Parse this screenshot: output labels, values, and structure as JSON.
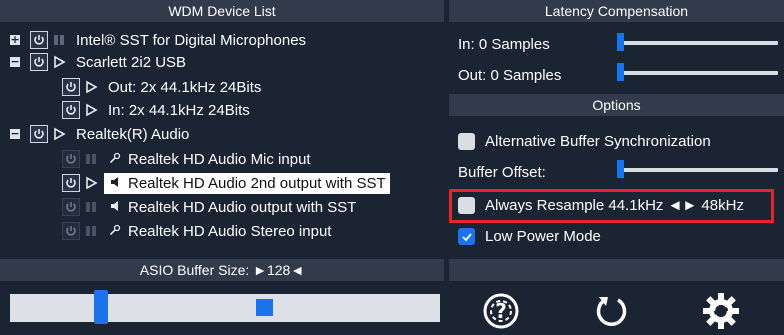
{
  "left_panel": {
    "header": "WDM Device List",
    "devices": [
      {
        "label": "Intel® SST for Digital Microphones",
        "expander": "+"
      },
      {
        "label": "Scarlett 2i2 USB",
        "expander": "−"
      },
      {
        "label": "Out: 2x 44.1kHz 24Bits"
      },
      {
        "label": "In: 2x 44.1kHz 24Bits"
      },
      {
        "label": "Realtek(R) Audio",
        "expander": "−"
      },
      {
        "label": "Realtek HD Audio Mic input"
      },
      {
        "label": "Realtek HD Audio 2nd output with SST"
      },
      {
        "label": "Realtek HD Audio output with SST"
      },
      {
        "label": "Realtek HD Audio Stereo input"
      }
    ],
    "buffer_header": "ASIO Buffer Size: ►128◄",
    "buffer_slider_value": 128
  },
  "right_panel": {
    "latency_header": "Latency Compensation",
    "in_label": "In: 0 Samples",
    "out_label": "Out: 0 Samples",
    "options_header": "Options",
    "alt_buffer_sync": {
      "label": "Alternative Buffer Synchronization",
      "checked": false
    },
    "buffer_offset_label": "Buffer Offset:",
    "always_resample": {
      "label": "Always Resample 44.1kHz ◄► 48kHz",
      "checked": false
    },
    "low_power": {
      "label": "Low Power Mode",
      "checked": true
    }
  },
  "colors": {
    "background": "#1b2433",
    "header": "#323b4b",
    "accent": "#1a73e8",
    "highlight_box": "#e8232a"
  },
  "icons": [
    "power-icon",
    "play-icon",
    "pause-icon",
    "speaker-icon",
    "mic-icon",
    "help-icon",
    "reset-icon",
    "settings-icon"
  ]
}
